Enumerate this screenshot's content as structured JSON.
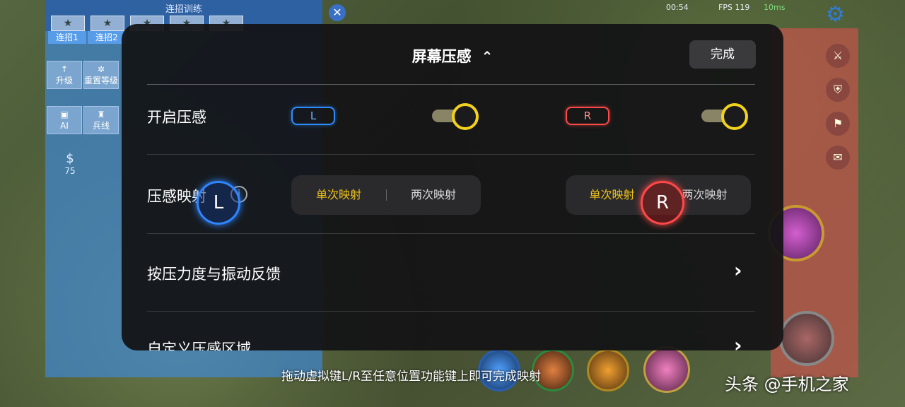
{
  "game_bg": {
    "training_title": "连招训练",
    "star_glyph": "★",
    "tabs": [
      "连招1",
      "连招2"
    ],
    "left_buttons": [
      {
        "icon": "↑",
        "label": "升级"
      },
      {
        "icon": "✲",
        "label": "重置等级"
      },
      {
        "icon": "▣",
        "label": "AI"
      },
      {
        "icon": "♜",
        "label": "兵线"
      }
    ],
    "coin_icon": "$",
    "coin_value": "75",
    "close_glyph": "✕",
    "clock": "00:54",
    "fps": "FPS 119",
    "ping": "10ms",
    "settings_icon": "gear-icon",
    "gear_glyph": "⚙"
  },
  "dialog": {
    "title": "屏幕压感",
    "title_chevron": "⌃",
    "done_label": "完成",
    "rows": {
      "enable": {
        "label": "开启压感",
        "left_key": "L",
        "right_key": "R",
        "left_toggle_on": true,
        "right_toggle_on": true
      },
      "mapping": {
        "label": "压感映射",
        "info_glyph": "i",
        "left_options": [
          "单次映射",
          "两次映射"
        ],
        "left_selected": "单次映射",
        "right_options": [
          "单次映射",
          "两次映射"
        ],
        "right_selected": "单次映射"
      },
      "feedback": {
        "label": "按压力度与振动反馈",
        "chevron": "›"
      },
      "custom_area": {
        "label": "自定义压感区域",
        "chevron": "›"
      }
    },
    "virtual_keys": {
      "left": "L",
      "right": "R"
    }
  },
  "hint_text": "拖动虚拟键L/R至任意位置功能键上即可完成映射",
  "watermark": "头条 @手机之家",
  "colors": {
    "accent_yellow": "#f2c418",
    "left_blue": "#2e8cff",
    "right_red": "#ff4a4a",
    "dialog_bg": "#121214"
  }
}
